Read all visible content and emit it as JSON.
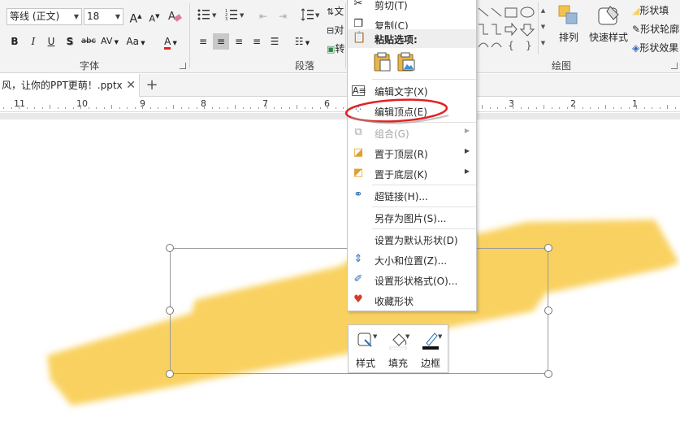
{
  "ribbon": {
    "font_name": "等线 (正文)",
    "font_size": "18",
    "grow_font": "A",
    "shrink_font": "A",
    "bold": "B",
    "italic": "I",
    "underline": "U",
    "shadow": "S",
    "strikethrough": "abc",
    "char_spacing": "AV",
    "change_case": "Aa",
    "font_color": "A",
    "font_group_label": "字体",
    "paragraph_group_label": "段落",
    "drawing_group_label": "绘图",
    "text_direction_partial": "文",
    "align_text_partial": "对",
    "convert_partial": "转",
    "arrange_label": "排列",
    "quick_styles_label": "快速样式",
    "shape_fill": "形状填",
    "shape_outline": "形状轮廓",
    "shape_effects": "形状效果"
  },
  "tabs": {
    "doc_title": "风，让你的PPT更萌！.pptx",
    "close": "✕",
    "add": "+"
  },
  "ruler": {
    "numbers": [
      "11",
      "10",
      "9",
      "8",
      "7",
      "6",
      "3",
      "2",
      "1"
    ]
  },
  "context_menu": {
    "cut": "剪切(T)",
    "copy": "复制(C)",
    "paste_options": "粘贴选项:",
    "edit_text": "编辑文字(X)",
    "edit_points": "编辑顶点(E)",
    "group": "组合(G)",
    "bring_to_front": "置于顶层(R)",
    "send_to_back": "置于底层(K)",
    "hyperlink": "超链接(H)...",
    "save_as_picture": "另存为图片(S)...",
    "set_default_shape": "设置为默认形状(D)",
    "size_position": "大小和位置(Z)...",
    "format_shape": "设置形状格式(O)...",
    "favorite_shape": "收藏形状"
  },
  "mini_toolbar": {
    "style": "样式",
    "fill": "填充",
    "outline": "边框"
  },
  "colors": {
    "accent_red": "#e32121",
    "stroke_yellow": "#f9d160",
    "ribbon_bg": "#f3f3f3"
  }
}
